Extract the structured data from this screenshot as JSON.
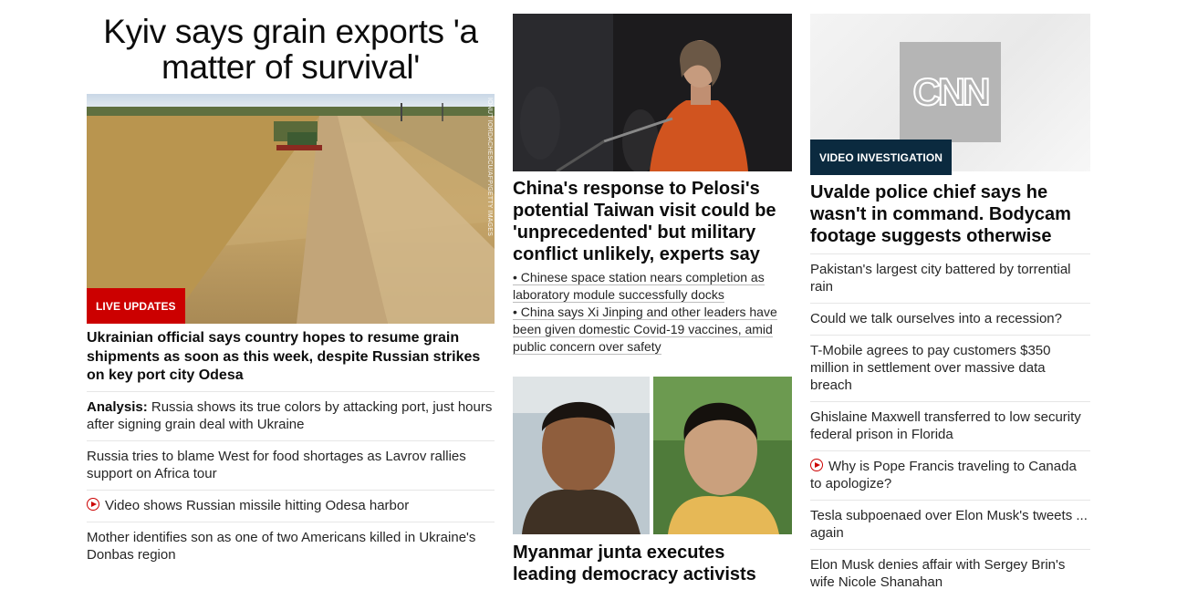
{
  "left": {
    "headline": "Kyiv says grain exports 'a matter of survival'",
    "image_credit": "IONUT IORDACHESCU/AFP/GETTY IMAGES",
    "badge": "LIVE UPDATES",
    "sub_headline": "Ukrainian official says country hopes to resume grain shipments as soon as this week, despite Russian strikes on key port city Odesa",
    "items": [
      {
        "prefix": "Analysis:",
        "text": " Russia shows its true colors by attacking port, just hours after signing grain deal with Ukraine",
        "video": false
      },
      {
        "prefix": "",
        "text": "Russia tries to blame West for food shortages as Lavrov rallies support on Africa tour",
        "video": false
      },
      {
        "prefix": "",
        "text": "Video shows Russian missile hitting Odesa harbor",
        "video": true
      },
      {
        "prefix": "",
        "text": "Mother identifies son as one of two Americans killed in Ukraine's Donbas region",
        "video": false
      }
    ]
  },
  "middle": {
    "headline1": "China's response to Pelosi's potential Taiwan visit could be 'unprecedented' but military conflict unlikely, experts say",
    "bullets": [
      "• Chinese space station nears completion as laboratory module successfully docks",
      "• China says Xi Jinping and other leaders have been given domestic Covid-19 vaccines, amid public concern over safety"
    ],
    "headline2": "Myanmar junta executes leading democracy activists"
  },
  "right": {
    "logo_text": "CNN",
    "badge": "VIDEO INVESTIGATION",
    "headline": "Uvalde police chief says he wasn't in command. Bodycam footage suggests otherwise",
    "items": [
      {
        "text": "Pakistan's largest city battered by torrential rain",
        "video": false
      },
      {
        "text": "Could we talk ourselves into a recession?",
        "video": false
      },
      {
        "text": "T-Mobile agrees to pay customers $350 million in settlement over massive data breach",
        "video": false
      },
      {
        "text": "Ghislaine Maxwell transferred to low security federal prison in Florida",
        "video": false
      },
      {
        "text": "Why is Pope Francis traveling to Canada to apologize?",
        "video": true
      },
      {
        "text": "Tesla subpoenaed over Elon Musk's tweets ... again",
        "video": false
      },
      {
        "text": "Elon Musk denies affair with Sergey Brin's wife Nicole Shanahan",
        "video": false
      }
    ]
  },
  "colors": {
    "live_badge": "#cc0000",
    "video_badge": "#0b2a3f",
    "play_icon": "#cc0000"
  }
}
